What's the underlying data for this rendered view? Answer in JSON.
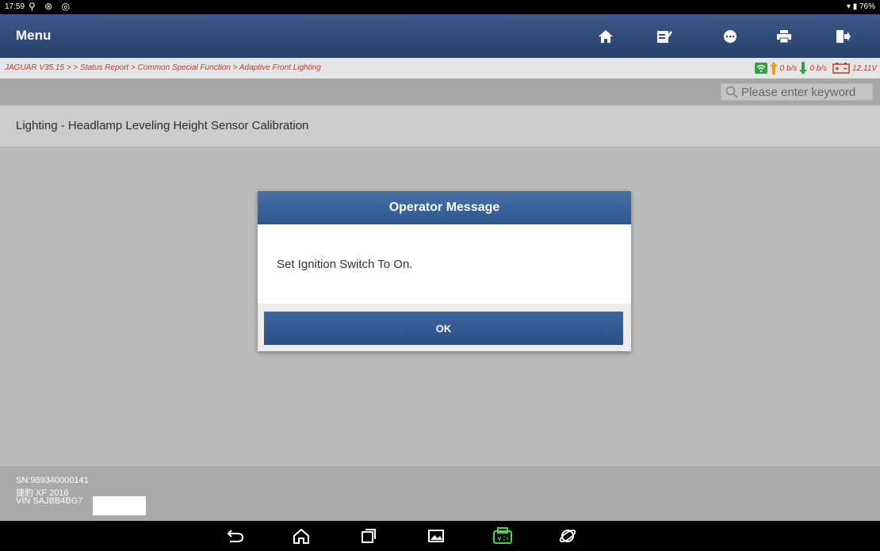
{
  "status_bar": {
    "time": "17:59",
    "battery": "76%"
  },
  "header": {
    "title": "Menu",
    "buttons": [
      "home",
      "edit",
      "chat",
      "print",
      "exit"
    ]
  },
  "breadcrumb": "JAGUAR V35.15 >  > Status Report > Common Special Function > Adaptive Front Lighting",
  "network": {
    "upload": "0 b/s",
    "download": "0 b/s",
    "voltage": "12.11V"
  },
  "search": {
    "placeholder": "Please enter keyword"
  },
  "page": {
    "title": "Lighting - Headlamp Leveling Height Sensor Calibration"
  },
  "dialog": {
    "title": "Operator Message",
    "message": "Set Ignition Switch To On.",
    "ok_label": "OK"
  },
  "footer": {
    "sn": "SN:989340000141",
    "model": "捷豹 XF 2016",
    "vin": "VIN SAJBB4BG7"
  },
  "colors": {
    "header": "#2f4c7a",
    "breadcrumb_text": "#c0392b",
    "dialog_header": "#3b62a0",
    "vci_icon": "#4bd34b"
  }
}
